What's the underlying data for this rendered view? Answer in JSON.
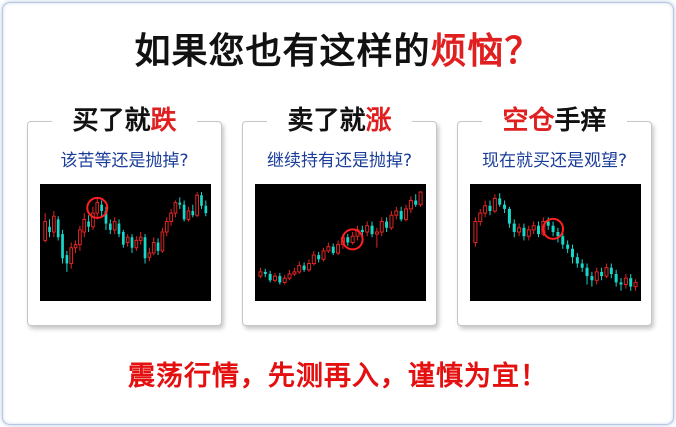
{
  "headline": {
    "main": "如果您也有这样的",
    "highlight": "烦恼？"
  },
  "panels": [
    {
      "title_black": "买了就",
      "title_red": "跌",
      "subtitle": "该苦等还是抛掉?",
      "candles": [
        [
          0.52,
          0.7,
          0.5,
          0.78
        ],
        [
          0.65,
          0.6,
          0.55,
          0.72
        ],
        [
          0.6,
          0.75,
          0.55,
          0.8
        ],
        [
          0.72,
          0.55,
          0.52,
          0.75
        ],
        [
          0.58,
          0.35,
          0.3,
          0.62
        ],
        [
          0.38,
          0.3,
          0.22,
          0.42
        ],
        [
          0.3,
          0.45,
          0.25,
          0.5
        ],
        [
          0.45,
          0.48,
          0.4,
          0.52
        ],
        [
          0.48,
          0.62,
          0.42,
          0.66
        ],
        [
          0.6,
          0.72,
          0.55,
          0.78
        ],
        [
          0.7,
          0.65,
          0.6,
          0.76
        ],
        [
          0.65,
          0.78,
          0.62,
          0.84
        ],
        [
          0.78,
          0.88,
          0.72,
          0.92
        ],
        [
          0.86,
          0.8,
          0.75,
          0.9
        ],
        [
          0.8,
          0.68,
          0.62,
          0.84
        ],
        [
          0.68,
          0.62,
          0.58,
          0.72
        ],
        [
          0.62,
          0.7,
          0.58,
          0.74
        ],
        [
          0.68,
          0.58,
          0.55,
          0.72
        ],
        [
          0.6,
          0.48,
          0.45,
          0.62
        ],
        [
          0.5,
          0.55,
          0.46,
          0.58
        ],
        [
          0.55,
          0.45,
          0.4,
          0.58
        ],
        [
          0.45,
          0.52,
          0.42,
          0.56
        ],
        [
          0.52,
          0.55,
          0.48,
          0.6
        ],
        [
          0.55,
          0.35,
          0.3,
          0.58
        ],
        [
          0.36,
          0.4,
          0.32,
          0.45
        ],
        [
          0.4,
          0.5,
          0.38,
          0.55
        ],
        [
          0.5,
          0.42,
          0.38,
          0.54
        ],
        [
          0.42,
          0.6,
          0.4,
          0.64
        ],
        [
          0.6,
          0.7,
          0.56,
          0.74
        ],
        [
          0.7,
          0.78,
          0.66,
          0.82
        ],
        [
          0.78,
          0.88,
          0.74,
          0.9
        ],
        [
          0.88,
          0.86,
          0.82,
          0.93
        ],
        [
          0.86,
          0.72,
          0.7,
          0.9
        ],
        [
          0.72,
          0.8,
          0.7,
          0.84
        ],
        [
          0.8,
          0.76,
          0.74,
          0.86
        ],
        [
          0.76,
          0.95,
          0.74,
          0.98
        ],
        [
          0.95,
          0.85,
          0.82,
          0.98
        ],
        [
          0.85,
          0.78,
          0.75,
          0.9
        ]
      ],
      "marker": 12
    },
    {
      "title_black": "卖了就",
      "title_red": "涨",
      "subtitle": "继续持有还是抛掉?",
      "candles": [
        [
          0.18,
          0.22,
          0.16,
          0.26
        ],
        [
          0.22,
          0.2,
          0.17,
          0.25
        ],
        [
          0.2,
          0.14,
          0.12,
          0.23
        ],
        [
          0.14,
          0.18,
          0.12,
          0.21
        ],
        [
          0.18,
          0.12,
          0.1,
          0.21
        ],
        [
          0.12,
          0.16,
          0.1,
          0.19
        ],
        [
          0.16,
          0.2,
          0.14,
          0.24
        ],
        [
          0.2,
          0.22,
          0.18,
          0.26
        ],
        [
          0.22,
          0.28,
          0.2,
          0.32
        ],
        [
          0.28,
          0.24,
          0.22,
          0.31
        ],
        [
          0.24,
          0.3,
          0.22,
          0.34
        ],
        [
          0.3,
          0.38,
          0.28,
          0.42
        ],
        [
          0.38,
          0.34,
          0.31,
          0.41
        ],
        [
          0.34,
          0.42,
          0.32,
          0.45
        ],
        [
          0.42,
          0.46,
          0.4,
          0.5
        ],
        [
          0.46,
          0.4,
          0.38,
          0.49
        ],
        [
          0.4,
          0.48,
          0.38,
          0.52
        ],
        [
          0.48,
          0.55,
          0.44,
          0.58
        ],
        [
          0.55,
          0.5,
          0.47,
          0.58
        ],
        [
          0.5,
          0.56,
          0.48,
          0.6
        ],
        [
          0.56,
          0.62,
          0.52,
          0.66
        ],
        [
          0.62,
          0.6,
          0.56,
          0.66
        ],
        [
          0.6,
          0.66,
          0.56,
          0.7
        ],
        [
          0.66,
          0.58,
          0.55,
          0.7
        ],
        [
          0.58,
          0.6,
          0.45,
          0.64
        ],
        [
          0.6,
          0.7,
          0.56,
          0.74
        ],
        [
          0.7,
          0.64,
          0.6,
          0.74
        ],
        [
          0.64,
          0.76,
          0.62,
          0.8
        ],
        [
          0.76,
          0.8,
          0.72,
          0.84
        ],
        [
          0.8,
          0.72,
          0.7,
          0.84
        ],
        [
          0.72,
          0.82,
          0.7,
          0.86
        ],
        [
          0.82,
          0.9,
          0.78,
          0.94
        ],
        [
          0.9,
          0.86,
          0.84,
          0.96
        ],
        [
          0.86,
          0.98,
          0.84,
          0.99
        ]
      ],
      "marker": 19
    },
    {
      "title_black": "手痒",
      "title_red": "空仓",
      "subtitle": "现在就买还是观望?",
      "candles": [
        [
          0.5,
          0.7,
          0.46,
          0.74
        ],
        [
          0.7,
          0.78,
          0.66,
          0.82
        ],
        [
          0.78,
          0.85,
          0.74,
          0.9
        ],
        [
          0.85,
          0.8,
          0.76,
          0.9
        ],
        [
          0.8,
          0.92,
          0.78,
          0.96
        ],
        [
          0.92,
          0.86,
          0.84,
          0.97
        ],
        [
          0.86,
          0.82,
          0.78,
          0.9
        ],
        [
          0.82,
          0.68,
          0.64,
          0.84
        ],
        [
          0.68,
          0.6,
          0.55,
          0.72
        ],
        [
          0.6,
          0.64,
          0.56,
          0.68
        ],
        [
          0.64,
          0.56,
          0.52,
          0.68
        ],
        [
          0.56,
          0.62,
          0.52,
          0.66
        ],
        [
          0.62,
          0.66,
          0.58,
          0.7
        ],
        [
          0.66,
          0.58,
          0.55,
          0.7
        ],
        [
          0.58,
          0.7,
          0.56,
          0.74
        ],
        [
          0.7,
          0.66,
          0.62,
          0.74
        ],
        [
          0.66,
          0.6,
          0.56,
          0.7
        ],
        [
          0.6,
          0.56,
          0.5,
          0.64
        ],
        [
          0.56,
          0.48,
          0.44,
          0.6
        ],
        [
          0.48,
          0.44,
          0.4,
          0.52
        ],
        [
          0.44,
          0.36,
          0.3,
          0.48
        ],
        [
          0.36,
          0.3,
          0.26,
          0.4
        ],
        [
          0.3,
          0.26,
          0.22,
          0.34
        ],
        [
          0.26,
          0.18,
          0.1,
          0.3
        ],
        [
          0.18,
          0.14,
          0.08,
          0.22
        ],
        [
          0.14,
          0.22,
          0.1,
          0.26
        ],
        [
          0.22,
          0.18,
          0.14,
          0.26
        ],
        [
          0.18,
          0.26,
          0.16,
          0.3
        ],
        [
          0.26,
          0.2,
          0.16,
          0.3
        ],
        [
          0.2,
          0.12,
          0.08,
          0.24
        ],
        [
          0.12,
          0.1,
          0.04,
          0.16
        ],
        [
          0.1,
          0.16,
          0.06,
          0.2
        ],
        [
          0.16,
          0.08,
          0.04,
          0.2
        ],
        [
          0.08,
          0.12,
          0.04,
          0.15
        ]
      ],
      "marker": 16
    }
  ],
  "footer": "震荡行情，先测再入，谨慎为宜！",
  "colors": {
    "up": "#e02424",
    "down": "#18d6c8",
    "highlight": "#e02020",
    "subtitle": "#1a3d9a",
    "circle": "#ff2020"
  }
}
